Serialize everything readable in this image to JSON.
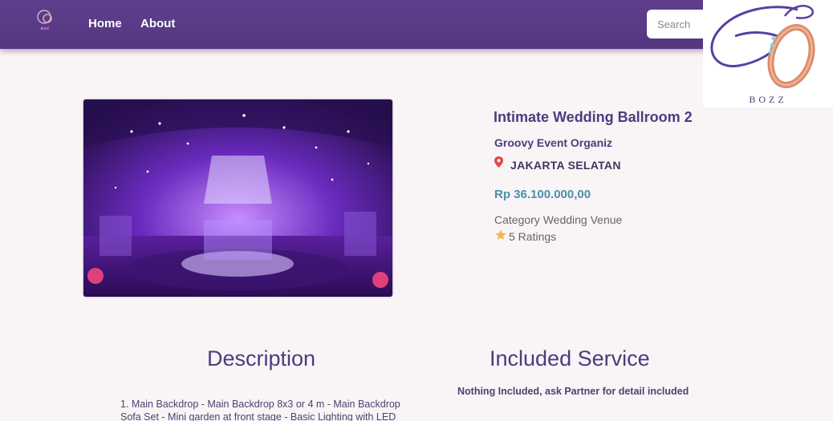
{
  "nav": {
    "home_label": "Home",
    "about_label": "About",
    "search_placeholder": "Search",
    "logo_icon": "eo-ring-logo-icon"
  },
  "brand": {
    "name": "BOZZ",
    "logo_icon": "wedding-ring-logo-icon"
  },
  "product": {
    "image_icon": "ballroom-photo",
    "title": "Intimate Wedding Ballroom 2",
    "organizer": "Groovy Event Organiz",
    "location_icon": "map-pin-icon",
    "location": "JAKARTA SELATAN",
    "price": "Rp 36.100.000,00",
    "category": "Category Wedding Venue",
    "rating_icon": "star-icon",
    "ratings": "5 Ratings"
  },
  "description": {
    "heading": "Description",
    "text": "1. Main Backdrop - Main Backdrop 8x3 or 4 m - Main Backdrop Sofa Set - Mini garden at front stage - Basic Lighting with LED"
  },
  "included": {
    "heading": "Included Service",
    "text": "Nothing Included, ask Partner for detail included"
  },
  "colors": {
    "navbar": "#5e3f8d",
    "accent_text": "#4f3a7e",
    "price": "#4a8fa6",
    "background": "#f9f4f6"
  }
}
